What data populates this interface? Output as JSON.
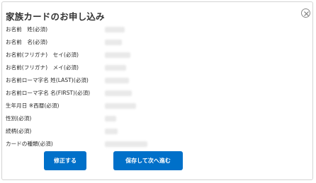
{
  "dialog": {
    "title": "家族カードのお申し込み",
    "close_icon": "close-circle-icon"
  },
  "fields": [
    {
      "label": "お名前　姓(必須)"
    },
    {
      "label": "お名前　名(必須)"
    },
    {
      "label": "お名前(フリガナ)　セイ(必須)"
    },
    {
      "label": "お名前(フリガナ)　メイ(必須)"
    },
    {
      "label": "お名前ローマ字名 姓(LAST)(必須)"
    },
    {
      "label": "お名前ローマ字名 名(FIRST)(必須)"
    },
    {
      "label": "生年月日 ※西暦(必須)"
    },
    {
      "label": "性別(必須)"
    },
    {
      "label": "続柄(必須)"
    },
    {
      "label": "カードの種類(必須)"
    }
  ],
  "buttons": {
    "fix_label": "修正する",
    "next_label": "保存して次へ進む"
  },
  "colors": {
    "primary_button": "#0070c9",
    "button_text": "#ffffff",
    "border": "#d4d4d4"
  }
}
